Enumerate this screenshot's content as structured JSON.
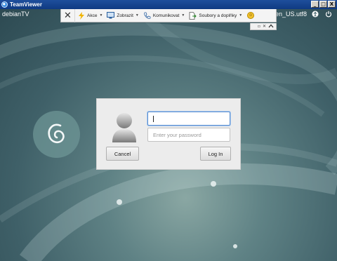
{
  "window": {
    "title": "TeamViewer",
    "controls": {
      "minimize": "_",
      "maximize": "□",
      "close": "X"
    }
  },
  "remote": {
    "hostname": "debianTV",
    "locale": "en_US.utf8"
  },
  "toolbar": {
    "close_glyph": "✕",
    "items": [
      {
        "label": "Akce",
        "icon": "lightning-icon"
      },
      {
        "label": "Zobrazit",
        "icon": "monitor-icon"
      },
      {
        "label": "Komunikovat",
        "icon": "phone-icon"
      },
      {
        "label": "Soubory a doplňky",
        "icon": "file-transfer-icon"
      }
    ],
    "feedback_icon": "smiley-icon"
  },
  "login": {
    "username_value": "",
    "password_placeholder": "Enter your password",
    "cancel_label": "Cancel",
    "login_label": "Log In"
  },
  "colors": {
    "titlebar": "#1e4f9c",
    "desktop": "#3f6068",
    "dialog": "#ececec",
    "focus": "#5b8fd0"
  }
}
